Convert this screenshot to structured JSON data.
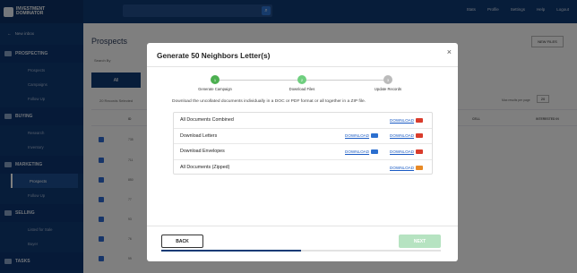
{
  "app": {
    "logo_text_1": "INVESTMENT",
    "logo_text_2": "DOMINATOR",
    "nav": [
      "Stats",
      "Profile",
      "Settings",
      "Help",
      "Logout"
    ]
  },
  "sidebar": {
    "back_label": "New inbox",
    "sections": [
      {
        "title": "PROSPECTING",
        "items": [
          "Prospects",
          "Campaigns",
          "Follow Up"
        ]
      },
      {
        "title": "BUYING",
        "items": [
          "Research",
          "Inventory"
        ]
      },
      {
        "title": "MARKETING",
        "items": [
          "Prospects",
          "Follow Up"
        ]
      },
      {
        "title": "SELLING",
        "items": [
          "Listed for Sale",
          "Buyer"
        ]
      },
      {
        "title": "TASKS",
        "items": []
      }
    ]
  },
  "background": {
    "page_title": "Prospects",
    "records_selected": "20 Records Selected",
    "tab_all": "All",
    "search_label": "Search By",
    "col_id": "ID",
    "col_cell": "CELL",
    "col_interested": "INTERESTED IN",
    "per_page_label": "Max results per page",
    "per_page_value": "20",
    "btn_new": "NEW FILES",
    "row_ids": [
      "735",
      "711",
      "850",
      "77",
      "93",
      "76",
      "99"
    ]
  },
  "modal": {
    "title": "Generate 50 Neighbors Letter(s)",
    "steps": [
      {
        "number": "1",
        "label": "Generate Campaign",
        "color": "#4caf50"
      },
      {
        "number": "2",
        "label": "Download Files",
        "color": "#6fcf7f"
      },
      {
        "number": "3",
        "label": "Update Records",
        "color": "#bbbbbb"
      }
    ],
    "description": "Download the uncollated documents individually in a DOC or PDF format or all together in a ZIP file.",
    "rows": [
      {
        "label": "All Documents Combined",
        "doc": "",
        "pdf": "DOWNLOAD"
      },
      {
        "label": "Download Letters",
        "doc": "DOWNLOAD",
        "pdf": "DOWNLOAD"
      },
      {
        "label": "Download Envelopes",
        "doc": "DOWNLOAD",
        "pdf": "DOWNLOAD"
      },
      {
        "label": "All Documents (Zipped)",
        "doc": "",
        "zip": "DOWNLOAD"
      }
    ],
    "back_label": "BACK",
    "next_label": "NEXT",
    "progress": 0.5
  }
}
